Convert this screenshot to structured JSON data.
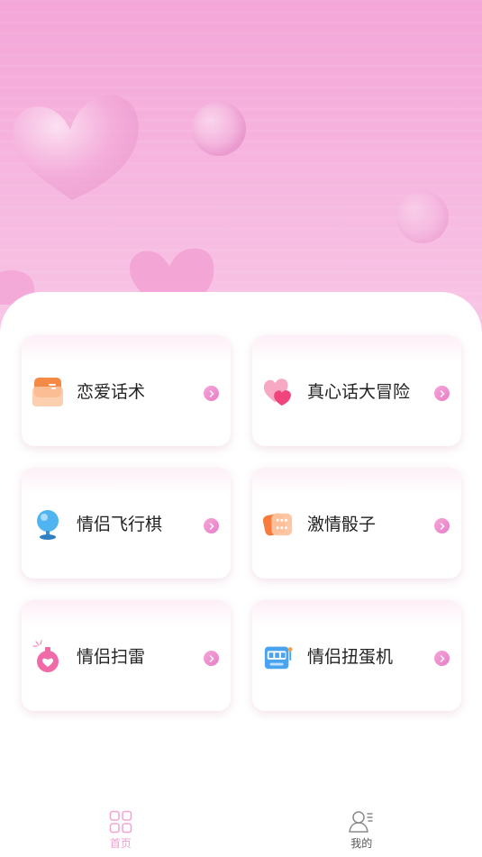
{
  "cards": [
    {
      "label": "恋爱话术",
      "icon": "love-letter-icon"
    },
    {
      "label": "真心话大冒险",
      "icon": "hearts-icon"
    },
    {
      "label": "情侣飞行棋",
      "icon": "globe-icon"
    },
    {
      "label": "激情骰子",
      "icon": "dice-icon"
    },
    {
      "label": "情侣扫雷",
      "icon": "bomb-icon"
    },
    {
      "label": "情侣扭蛋机",
      "icon": "slot-machine-icon"
    }
  ],
  "tabs": {
    "home": {
      "label": "首页",
      "icon": "grid-icon",
      "active": true
    },
    "mine": {
      "label": "我的",
      "icon": "user-icon",
      "active": false
    }
  },
  "colors": {
    "accent": "#ef9ccd",
    "hero_top": "#f4a6d8",
    "hero_bottom": "#f8c7e6"
  }
}
